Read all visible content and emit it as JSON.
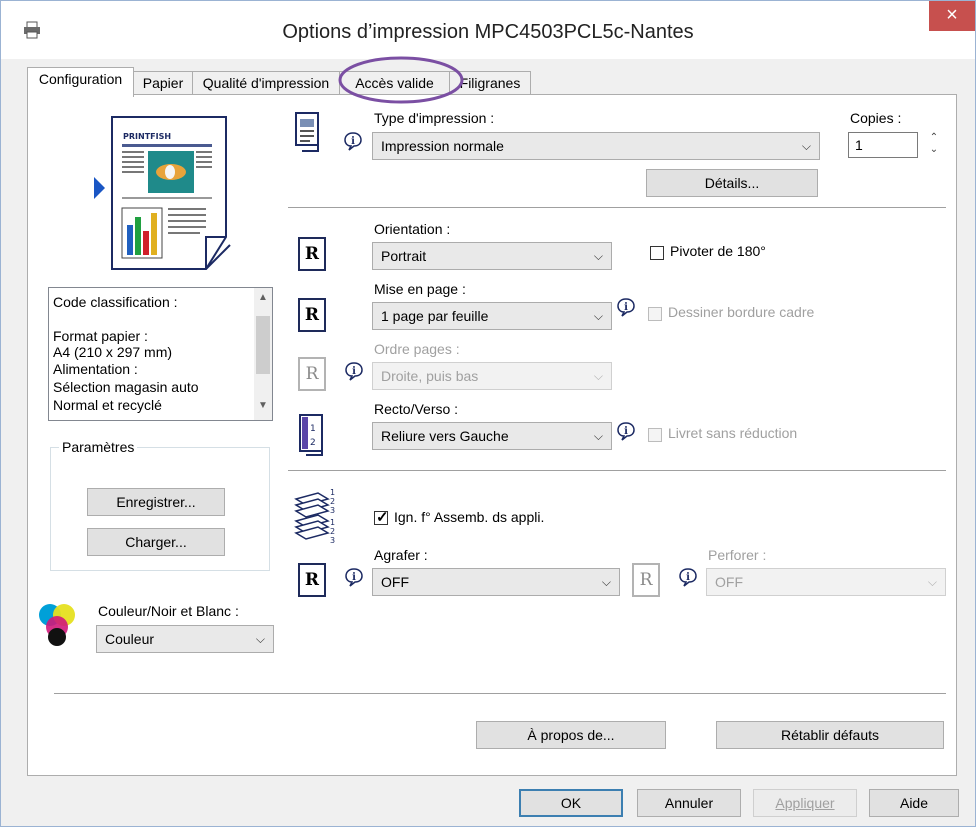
{
  "window": {
    "title": "Options d’impression MPC4503PCL5c-Nantes",
    "close_label": "×"
  },
  "tabs": [
    {
      "label": "Configuration"
    },
    {
      "label": "Papier"
    },
    {
      "label": "Qualité d'impression"
    },
    {
      "label": "Accès valide"
    },
    {
      "label": "Filigranes"
    }
  ],
  "left": {
    "preview_logo_text": "PRINTFISH",
    "info_list": [
      "Code classification :",
      "",
      "Format papier :",
      " A4 (210 x 297 mm)",
      "Alimentation :",
      " Sélection magasin auto",
      " Normal et recyclé"
    ],
    "params_title": "Paramètres",
    "save_label": "Enregistrer...",
    "load_label": "Charger...",
    "color_label": "Couleur/Noir et Blanc :",
    "color_value": "Couleur"
  },
  "print_type": {
    "label": "Type d'impression :",
    "value": "Impression normale",
    "copies_label": "Copies :",
    "copies_value": "1",
    "details_label": "Détails..."
  },
  "layout": {
    "orientation_label": "Orientation :",
    "orientation_value": "Portrait",
    "rotate_label": "Pivoter de 180°",
    "rotate_checked": false,
    "pages_label": "Mise en page :",
    "pages_value": "1 page par feuille",
    "border_label": "Dessiner bordure cadre",
    "order_label": "Ordre pages :",
    "order_value": "Droite, puis bas",
    "duplex_label": "Recto/Verso :",
    "duplex_value": "Reliure vers Gauche",
    "booklet_label": "Livret sans réduction",
    "r_glyph": "R"
  },
  "finishing": {
    "collate_label": "Ign. f° Assemb. ds appli.",
    "collate_checked": true,
    "staple_label": "Agrafer :",
    "staple_value": "OFF",
    "punch_label": "Perforer :",
    "punch_value": "OFF"
  },
  "footer": {
    "about_label": "À propos de...",
    "reset_label": "Rétablir défauts",
    "ok_label": "OK",
    "cancel_label": "Annuler",
    "apply_label": "Appliquer",
    "help_label": "Aide"
  },
  "colors": {
    "highlight_circle": "#7b4fa3",
    "selection_arrow": "#1a56c4",
    "default_button_border": "#3c7fb1",
    "close_button": "#c7504e"
  }
}
